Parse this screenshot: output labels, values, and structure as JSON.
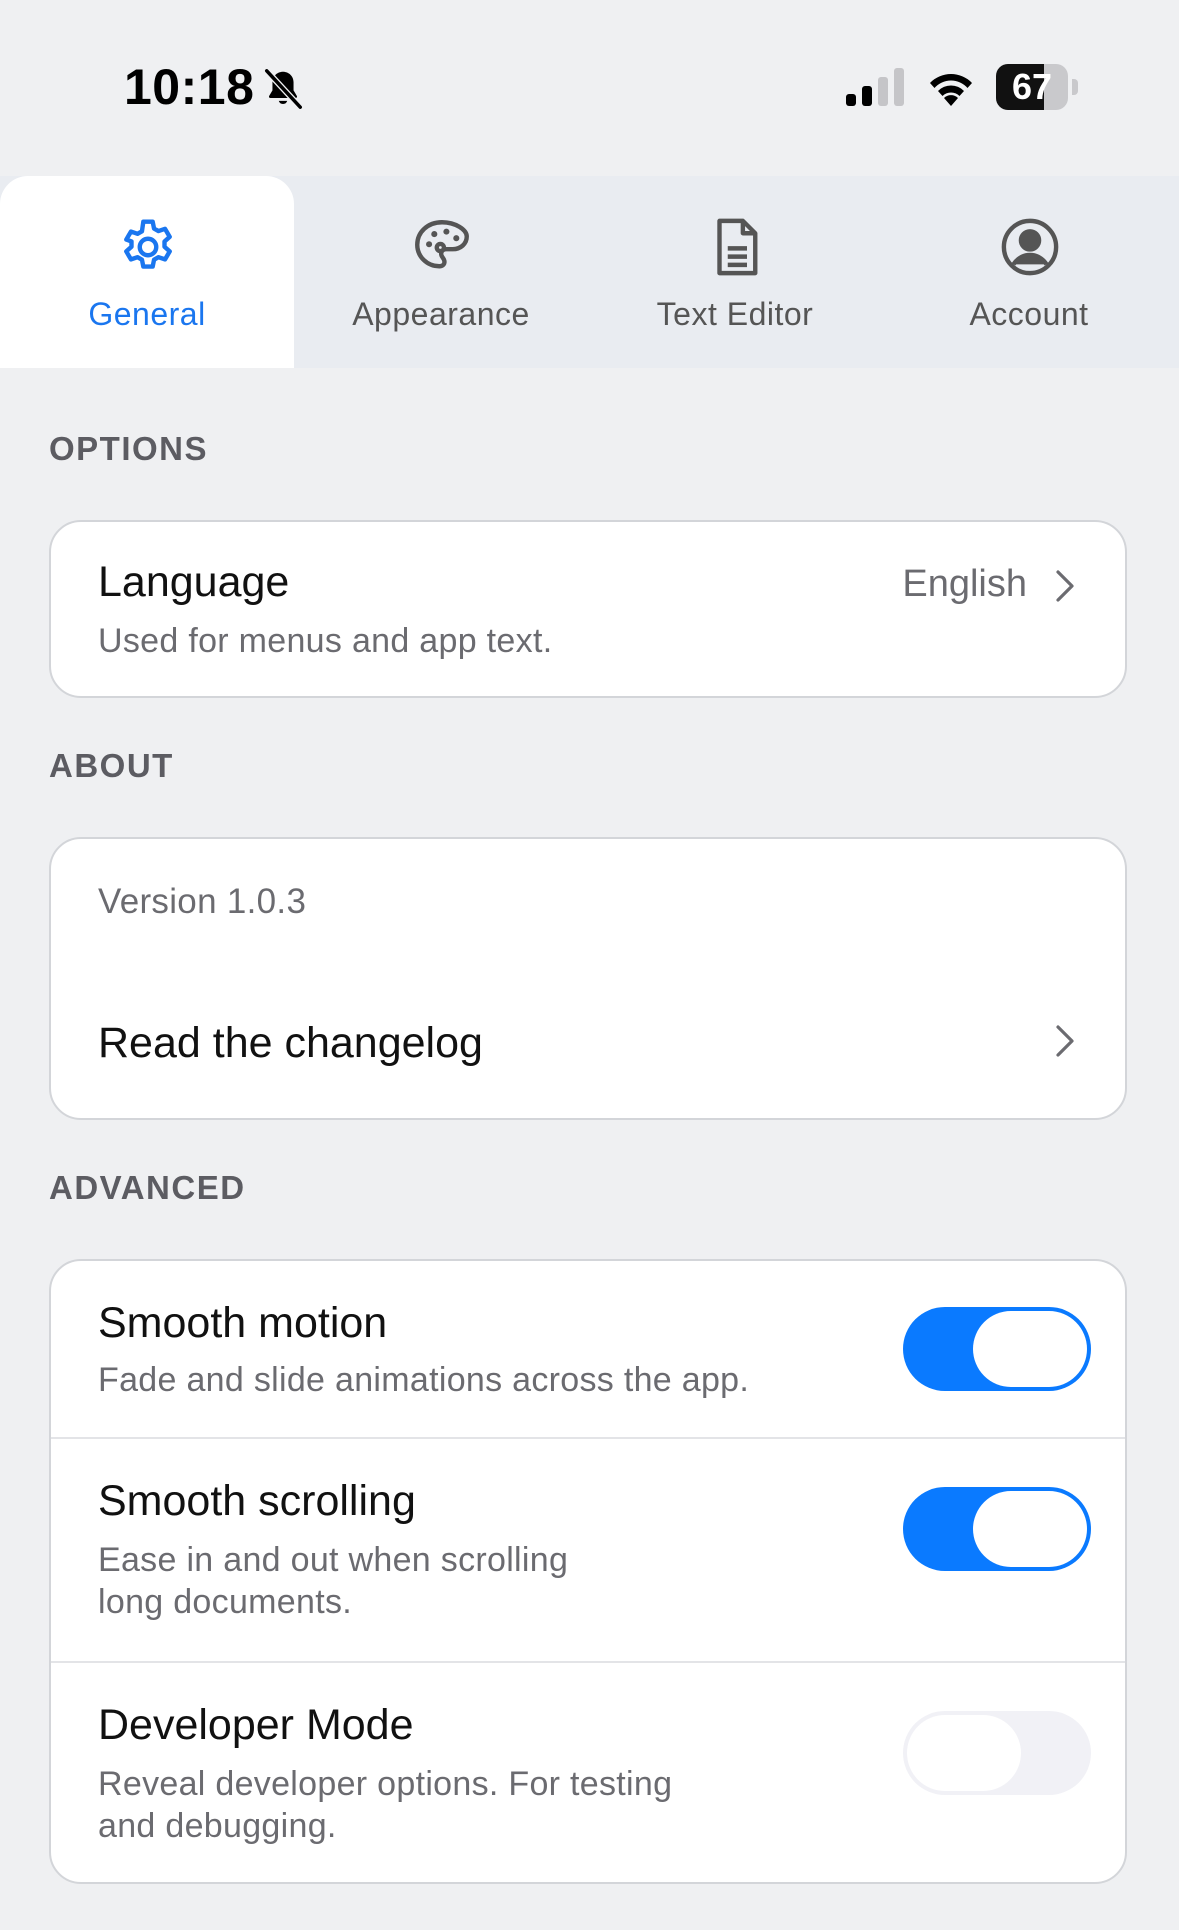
{
  "status_bar": {
    "time": "10:18",
    "battery": "67",
    "battery_level": 0.67,
    "icons": [
      "bell-slash-icon",
      "signal-icon",
      "wifi-icon",
      "battery-icon"
    ]
  },
  "tabs": [
    {
      "label": "General",
      "icon": "gear-icon",
      "active": true
    },
    {
      "label": "Appearance",
      "icon": "palette-icon",
      "active": false
    },
    {
      "label": "Text Editor",
      "icon": "document-icon",
      "active": false
    },
    {
      "label": "Account",
      "icon": "person-circle-icon",
      "active": false
    }
  ],
  "options": {
    "header": "OPTIONS",
    "language": {
      "title": "Language",
      "subtitle": "Used for menus and app text.",
      "value": "English"
    }
  },
  "about": {
    "header": "ABOUT",
    "version": "Version 1.0.3",
    "changelog": "Read the changelog"
  },
  "advanced": {
    "header": "ADVANCED",
    "items": [
      {
        "title": "Smooth motion",
        "subtitle_lines": [
          "Fade and slide animations across the app."
        ],
        "enabled": true
      },
      {
        "title": "Smooth scrolling",
        "subtitle_lines": [
          "Ease in and out when scrolling",
          "long documents."
        ],
        "enabled": true
      },
      {
        "title": "Developer Mode",
        "subtitle_lines": [
          "Reveal developer options. For testing",
          "and debugging."
        ],
        "enabled": false
      }
    ]
  },
  "colors": {
    "accent": "#0a7aff",
    "tab_active": "#1a76ef",
    "background": "#eff0f2"
  }
}
